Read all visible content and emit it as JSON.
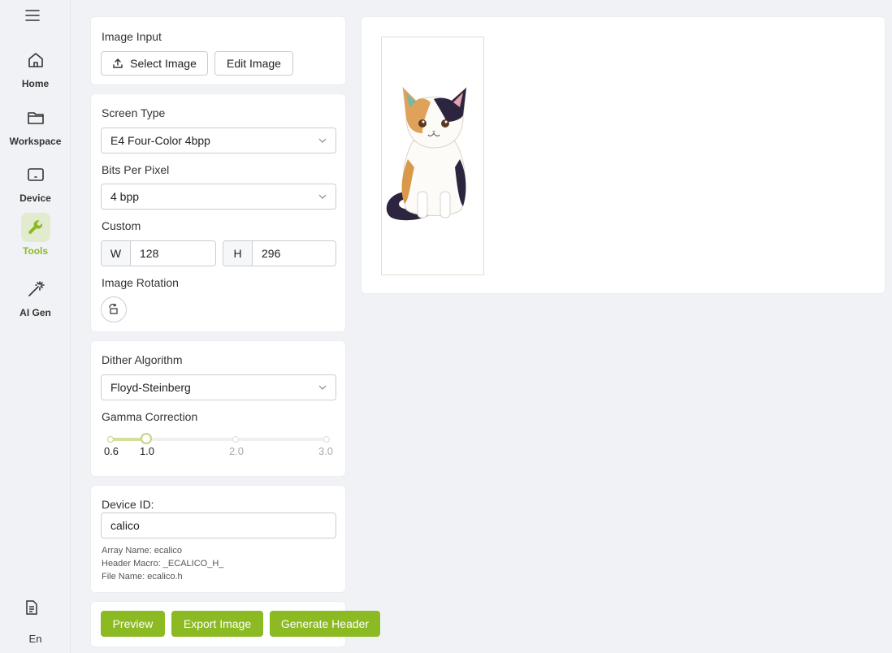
{
  "sidebar": {
    "items": [
      {
        "label": "Home",
        "icon": "home-icon"
      },
      {
        "label": "Workspace",
        "icon": "folder-icon"
      },
      {
        "label": "Device",
        "icon": "device-icon"
      },
      {
        "label": "Tools",
        "icon": "wrench-icon"
      },
      {
        "label": "AI Gen",
        "icon": "magic-wand-icon"
      }
    ],
    "active": "Tools",
    "language": "En"
  },
  "image_input": {
    "title": "Image Input",
    "select_label": "Select Image",
    "edit_label": "Edit Image"
  },
  "screen": {
    "type_label": "Screen Type",
    "type_value": "E4 Four-Color 4bpp",
    "bpp_label": "Bits Per Pixel",
    "bpp_value": "4 bpp",
    "custom_label": "Custom",
    "width_tag": "W",
    "width_value": "128",
    "height_tag": "H",
    "height_value": "296",
    "rotation_label": "Image Rotation"
  },
  "dither": {
    "algo_label": "Dither Algorithm",
    "algo_value": "Floyd-Steinberg",
    "gamma_label": "Gamma Correction",
    "gamma_min": 0.6,
    "gamma_max": 3.0,
    "gamma_value": 1.0,
    "marks": [
      "0.6",
      "1.0",
      "2.0",
      "3.0"
    ]
  },
  "device": {
    "id_label": "Device ID:",
    "id_value": "calico",
    "array_name": "Array Name: ecalico",
    "header_macro": "Header Macro: _ECALICO_H_",
    "file_name": "File Name: ecalico.h"
  },
  "actions": {
    "preview": "Preview",
    "export": "Export Image",
    "generate": "Generate Header"
  },
  "colors": {
    "accent": "#8cba22",
    "accent_light": "#e3ebcf"
  }
}
